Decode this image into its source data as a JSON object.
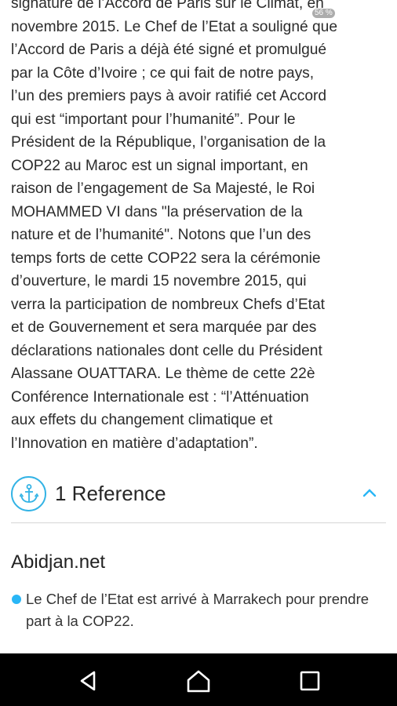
{
  "article": {
    "lines": [
      "signature de l’Accord de Paris sur le Climat, en",
      "novembre 2015. Le Chef de l’Etat a souligné que",
      "l’Accord de Paris a déjà été signé et promulgué",
      "par la Côte d’Ivoire ; ce qui fait de notre pays,",
      "l’un des premiers pays à avoir ratifié cet Accord",
      "qui est “important pour l’humanité”. Pour le",
      "Président de la République, l’organisation de la",
      "COP22 au Maroc est un signal important, en",
      "raison de l’engagement de Sa Majesté, le Roi",
      "MOHAMMED VI dans \"la préservation de la",
      "nature et de l’humanité\". Notons que l’un des",
      "temps forts de cette COP22 sera la cérémonie",
      "d’ouverture, le mardi 15 novembre 2015, qui",
      "verra la participation de nombreux Chefs d’Etat",
      "et de Gouvernement et sera marquée par des",
      "déclarations nationales dont celle du Président",
      "Alassane OUATTARA. Le thème de cette 22è",
      "Conférence Internationale est : “l’Atténuation",
      "aux effets du changement climatique et",
      "l’Innovation en matière d’adaptation”."
    ]
  },
  "zoom_badge": "56 %",
  "references": {
    "title": "1 Reference",
    "icon": "anchor-icon",
    "accent_color": "#33b3e5",
    "source": "Abidjan.net",
    "items": [
      "Le Chef de l’Etat est arrivé à Marrakech pour prendre part à la COP22."
    ]
  },
  "navbar": {
    "icons": [
      "back-icon",
      "home-icon",
      "recents-icon"
    ]
  }
}
